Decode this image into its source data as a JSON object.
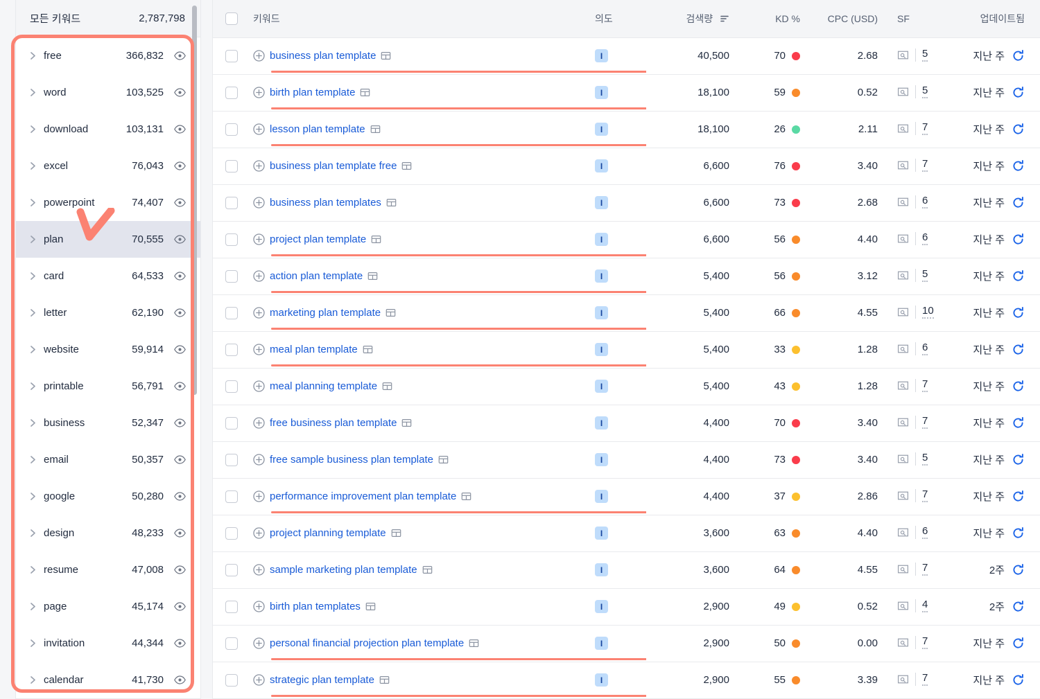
{
  "sidebar": {
    "header": {
      "title": "모든 키워드",
      "count": "2,787,798"
    },
    "items": [
      {
        "label": "free",
        "volume": "366,832",
        "selected": false
      },
      {
        "label": "word",
        "volume": "103,525",
        "selected": false
      },
      {
        "label": "download",
        "volume": "103,131",
        "selected": false
      },
      {
        "label": "excel",
        "volume": "76,043",
        "selected": false
      },
      {
        "label": "powerpoint",
        "volume": "74,407",
        "selected": false
      },
      {
        "label": "plan",
        "volume": "70,555",
        "selected": true
      },
      {
        "label": "card",
        "volume": "64,533",
        "selected": false
      },
      {
        "label": "letter",
        "volume": "62,190",
        "selected": false
      },
      {
        "label": "website",
        "volume": "59,914",
        "selected": false
      },
      {
        "label": "printable",
        "volume": "56,791",
        "selected": false
      },
      {
        "label": "business",
        "volume": "52,347",
        "selected": false
      },
      {
        "label": "email",
        "volume": "50,357",
        "selected": false
      },
      {
        "label": "google",
        "volume": "50,280",
        "selected": false
      },
      {
        "label": "design",
        "volume": "48,233",
        "selected": false
      },
      {
        "label": "resume",
        "volume": "47,008",
        "selected": false
      },
      {
        "label": "page",
        "volume": "45,174",
        "selected": false
      },
      {
        "label": "invitation",
        "volume": "44,344",
        "selected": false
      },
      {
        "label": "calendar",
        "volume": "41,730",
        "selected": false
      }
    ]
  },
  "table": {
    "headers": {
      "keyword": "키워드",
      "intent": "의도",
      "volume": "검색량",
      "kd": "KD %",
      "cpc": "CPC (USD)",
      "sf": "SF",
      "updated": "업데이트됨"
    },
    "sorted_column": "volume",
    "rows": [
      {
        "keyword": "business plan template",
        "intent": "I",
        "volume": "40,500",
        "kd": "70",
        "kd_color": "#fa3c4b",
        "cpc": "2.68",
        "sf": "5",
        "updated": "지난 주",
        "highlight": true,
        "u_kw_width": 645
      },
      {
        "keyword": "birth plan template",
        "intent": "I",
        "volume": "18,100",
        "kd": "59",
        "kd_color": "#f98b2b",
        "cpc": "0.52",
        "sf": "5",
        "updated": "지난 주",
        "highlight": true,
        "u_kw_width": 645
      },
      {
        "keyword": "lesson plan template",
        "intent": "I",
        "volume": "18,100",
        "kd": "26",
        "kd_color": "#5ad9a4",
        "cpc": "2.11",
        "sf": "7",
        "updated": "지난 주",
        "highlight": true,
        "u_kw_width": 645
      },
      {
        "keyword": "business plan template free",
        "intent": "I",
        "volume": "6,600",
        "kd": "76",
        "kd_color": "#fa3c4b",
        "cpc": "3.40",
        "sf": "7",
        "updated": "지난 주",
        "highlight": false,
        "u_kw_width": 0
      },
      {
        "keyword": "business plan templates",
        "intent": "I",
        "volume": "6,600",
        "kd": "73",
        "kd_color": "#fa3c4b",
        "cpc": "2.68",
        "sf": "6",
        "updated": "지난 주",
        "highlight": false,
        "u_kw_width": 0
      },
      {
        "keyword": "project plan template",
        "intent": "I",
        "volume": "6,600",
        "kd": "56",
        "kd_color": "#f98b2b",
        "cpc": "4.40",
        "sf": "6",
        "updated": "지난 주",
        "highlight": true,
        "u_kw_width": 645
      },
      {
        "keyword": "action plan template",
        "intent": "I",
        "volume": "5,400",
        "kd": "56",
        "kd_color": "#f98b2b",
        "cpc": "3.12",
        "sf": "5",
        "updated": "지난 주",
        "highlight": true,
        "u_kw_width": 645
      },
      {
        "keyword": "marketing plan template",
        "intent": "I",
        "volume": "5,400",
        "kd": "66",
        "kd_color": "#f98b2b",
        "cpc": "4.55",
        "sf": "10",
        "updated": "지난 주",
        "highlight": true,
        "u_kw_width": 645
      },
      {
        "keyword": "meal plan template",
        "intent": "I",
        "volume": "5,400",
        "kd": "33",
        "kd_color": "#fcc02e",
        "cpc": "1.28",
        "sf": "6",
        "updated": "지난 주",
        "highlight": true,
        "u_kw_width": 645
      },
      {
        "keyword": "meal planning template",
        "intent": "I",
        "volume": "5,400",
        "kd": "43",
        "kd_color": "#fcc02e",
        "cpc": "1.28",
        "sf": "7",
        "updated": "지난 주",
        "highlight": false,
        "u_kw_width": 0
      },
      {
        "keyword": "free business plan template",
        "intent": "I",
        "volume": "4,400",
        "kd": "70",
        "kd_color": "#fa3c4b",
        "cpc": "3.40",
        "sf": "7",
        "updated": "지난 주",
        "highlight": false,
        "u_kw_width": 0
      },
      {
        "keyword": "free sample business plan template",
        "intent": "I",
        "volume": "4,400",
        "kd": "73",
        "kd_color": "#fa3c4b",
        "cpc": "3.40",
        "sf": "5",
        "updated": "지난 주",
        "highlight": false,
        "u_kw_width": 0
      },
      {
        "keyword": "performance improvement plan template",
        "intent": "I",
        "volume": "4,400",
        "kd": "37",
        "kd_color": "#fcc02e",
        "cpc": "2.86",
        "sf": "7",
        "updated": "지난 주",
        "highlight": true,
        "u_kw_width": 645
      },
      {
        "keyword": "project planning template",
        "intent": "I",
        "volume": "3,600",
        "kd": "63",
        "kd_color": "#f98b2b",
        "cpc": "4.40",
        "sf": "6",
        "updated": "지난 주",
        "highlight": false,
        "u_kw_width": 0
      },
      {
        "keyword": "sample marketing plan template",
        "intent": "I",
        "volume": "3,600",
        "kd": "64",
        "kd_color": "#f98b2b",
        "cpc": "4.55",
        "sf": "7",
        "updated": "2주",
        "highlight": false,
        "u_kw_width": 0
      },
      {
        "keyword": "birth plan templates",
        "intent": "I",
        "volume": "2,900",
        "kd": "49",
        "kd_color": "#fcc02e",
        "cpc": "0.52",
        "sf": "4",
        "updated": "2주",
        "highlight": false,
        "u_kw_width": 0
      },
      {
        "keyword": "personal financial projection plan template",
        "intent": "I",
        "volume": "2,900",
        "kd": "50",
        "kd_color": "#f98b2b",
        "cpc": "0.00",
        "sf": "7",
        "updated": "지난 주",
        "highlight": true,
        "u_kw_width": 645
      },
      {
        "keyword": "strategic plan template",
        "intent": "I",
        "volume": "2,900",
        "kd": "55",
        "kd_color": "#f98b2b",
        "cpc": "3.39",
        "sf": "7",
        "updated": "지난 주",
        "highlight": true,
        "u_kw_width": 645
      }
    ]
  },
  "annotation": {
    "color": "#fb8272"
  }
}
